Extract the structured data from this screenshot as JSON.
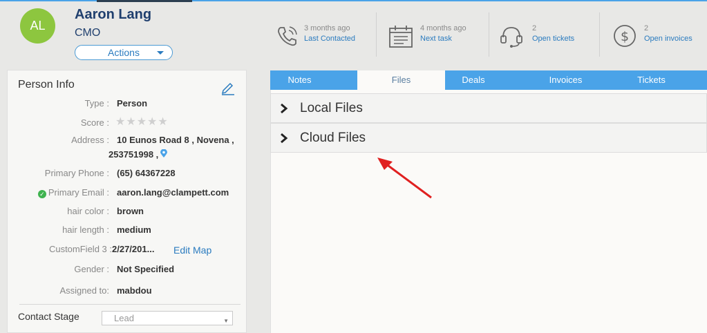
{
  "contact": {
    "initials": "AL",
    "name": "Aaron Lang",
    "title": "CMO",
    "actions_label": "Actions"
  },
  "stats": [
    {
      "top": "3 months ago",
      "bottom": "Last Contacted",
      "icon": "phone-icon"
    },
    {
      "top": "4 months ago",
      "bottom": "Next task",
      "icon": "calendar-icon"
    },
    {
      "top": "2",
      "bottom": "Open tickets",
      "icon": "headset-icon"
    },
    {
      "top": "2",
      "bottom": "Open invoices",
      "icon": "dollar-icon"
    }
  ],
  "person_info": {
    "heading": "Person Info",
    "type_label": "Type :",
    "type_value": "Person",
    "score_label": "Score :",
    "address_label": "Address :",
    "address_line1": "10 Eunos Road 8 , Novena ,",
    "address_line2": "253751998 ,",
    "phone_label": "Primary Phone :",
    "phone_value": "(65) 64367228",
    "email_label": "Primary Email :",
    "email_value": "aaron.lang@clampett.com",
    "hair_color_label": "hair color :",
    "hair_color_value": "brown",
    "hair_length_label": "hair length :",
    "hair_length_value": "medium",
    "custom3_label": "CustomField 3 :",
    "custom3_value": "2/27/201...",
    "edit_map": "Edit Map",
    "gender_label": "Gender :",
    "gender_value": "Not Specified",
    "assigned_label": "Assigned to:",
    "assigned_value": "mabdou",
    "contact_stage_label": "Contact Stage",
    "contact_stage_value": "Lead"
  },
  "tabs": [
    "Notes",
    "Files",
    "Deals",
    "Invoices",
    "Tickets"
  ],
  "active_tab": "Files",
  "file_sections": [
    "Local Files",
    "Cloud Files"
  ],
  "colors": {
    "accent": "#4aa3e8",
    "avatar": "#8dc63f",
    "name": "#1f3f6e",
    "link": "#2a7bbf",
    "annotation_arrow": "#e02020"
  }
}
